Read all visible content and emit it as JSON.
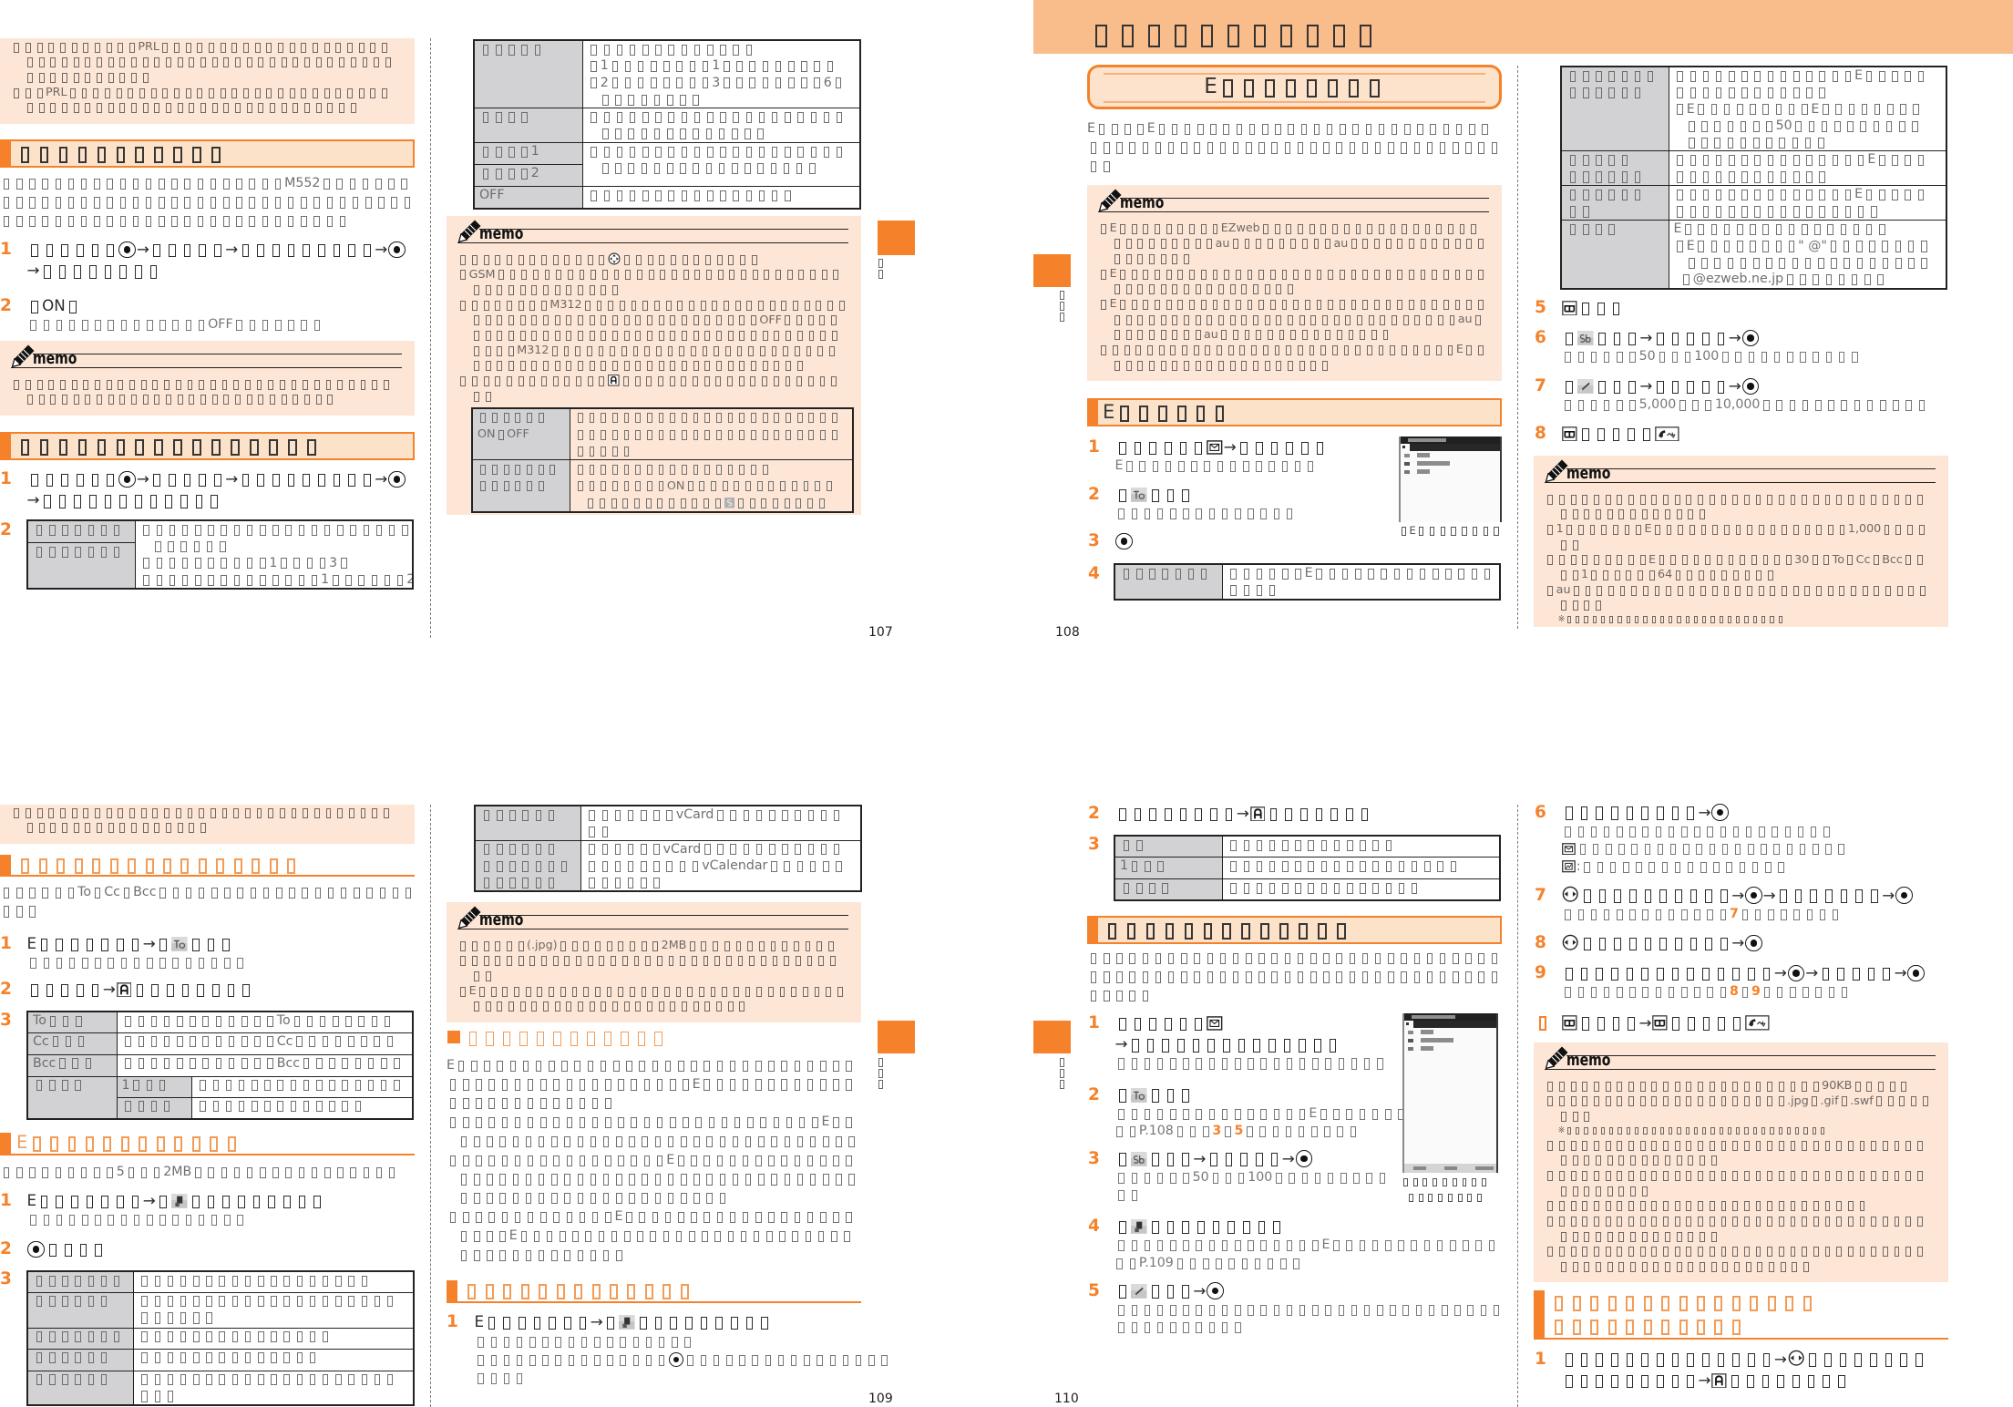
{
  "theme": {
    "accent": "#f5822a",
    "memo_bg": "#fde6d6",
    "heading_bg": "#fde2ca",
    "band_bg": "#f9bc8b",
    "table_label_bg": "#d2d2d4"
  },
  "p107": {
    "page_number": "107",
    "side_tab": "□□",
    "l": {
      "memo": {
        "items": [
          "□□□□□□□□□□□PRL□□□□□□□□□□□□□□□□□□□□□□□□□□□□□□□□□□□□□□□□□□□□□□□□□□□□□□□□□□□□□□□",
          "□□□PRL□□□□□□□□□□□□□□□□□□□□□□□□□□□□□□□□□□□□□□□□□□□□□□□□□□□□□□□□□"
        ]
      },
      "s1": {
        "title": "□□□□□□□□□□□",
        "body": "□□□□□□□□□□□□□□□□□□□□□□M552□□□□□□□□□□□□□□□□□□□□□□□□□□□□□□□□□□□□□□□□□□□□□□□□□□□□□□□□□□□□□□□□□□",
        "steps": [
          {
            "num": "1",
            "title": [
              "□□□□□□◉→□□□□□→□□□□□□□□□→◉",
              "→□□□□□□□□"
            ]
          },
          {
            "num": "2",
            "title": [
              "□ON□"
            ],
            "sub": [
              "□□□□□□□□□□□□□□OFF□□□□□□□"
            ]
          }
        ],
        "memo": {
          "title": "memo",
          "items": [
            "□□□□□□□□□□□□□□□□□□□□□□□□□□□□□□□□□□□□□□□□□□□□□□□□□□□□□□□□□□□□"
          ]
        }
      },
      "s2": {
        "title": "□□□□□□□□□□□□□□□□",
        "steps": [
          {
            "num": "1",
            "title": [
              "□□□□□□◉→□□□□□→□□□□□□□□□→◉",
              "→□□□□□□□□□□□□"
            ]
          },
          {
            "num": "2",
            "table": {
              "labels": [
                "□□□□□□□",
                "□□□□□□□"
              ],
              "desc": [
                "□□□□□□□□□□□□□□□□□□□□□",
                "□□□□□□",
                "□□□□□□□□□□1□□□□3□",
                "□□□□□□□□□□□□□□1□□□□□□2□"
              ]
            }
          }
        ]
      }
    },
    "r": {
      "table": {
        "rows": [
          {
            "label": "□□□□□",
            "desc": [
              "□□□□□□□□□□□□□",
              "□1□□□□□□□□1□□□□□□□□□",
              "□2□□□□□□□□3□□□□□□□□6□",
              "□□□□□□□□"
            ]
          },
          {
            "label": "□□□□",
            "desc": [
              "□□□□□□□□□□□□□□□□□□□□",
              "□□□□□□□□□□□□□"
            ]
          },
          {
            "label": "□□□□1",
            "desc": [
              "□□□□□□□□□□□□□□□□□□□□",
              "□□□□□□□□□□□□□□□□□"
            ]
          },
          {
            "label": "□□□□2"
          },
          {
            "label": "OFF",
            "desc": [
              "□□□□□□□□□□□□□□□□"
            ]
          }
        ]
      },
      "memo": {
        "title": "memo",
        "items": [
          "□□□□□□□□□□□□□⊕□□□□□□□□□□□□",
          "□GSM□□□□□□□□□□□□□□□□□□□□□□□□□□□□□□□□□□□□□□□□□□□",
          "□□□□□□□□M312□□□□□□□□□□□□□□□□□□□□□□□□□□□□□□□□□□□□□□□□□□□□□□□□OFF□□□□□□□□□□□□□□□□□□□□□□□□□□□□□□□□□□□□□□□□□M312□□□□□□□□□□□□□□□□□□□□□□□□□□□□□□□□□□□□□□□□□□□□□□□□□□□□□□",
          "□□□□□□□□□□□□□Ⓐ□□□□□□□□□□□□□□□□□□□□□"
        ],
        "table": {
          "rows": [
            {
              "label": [
                "□□□□□□",
                "ON□OFF"
              ],
              "desc": [
                "□□□□□□□□□□□□□□□□□□□□□□□",
                "□□□□□□□□□□□□□□□□□□□□□□□",
                "□□□□□"
              ]
            },
            {
              "label": [
                "□□□□□□□",
                "□□□□□□"
              ],
              "desc": [
                "□□□□□□□□□□□□□□□□□",
                "□□□□□□□□ON□□□□□□□□□□□□□",
                "□□□□□□□□□□□□ⓢ□□□□□□□□"
              ]
            }
          ]
        }
      }
    }
  },
  "p108": {
    "page_number": "108",
    "side_tab": "□□□",
    "chapter_title": "□□□□□□□□□□□",
    "topic_title": "E□□□□□□□□",
    "l": {
      "body": "E□□□□E□□□□□□□□□□□□□□□□□□□□□□□□□□□□□□□□□□□□□□□□□□□□□□□□□□□□□□□□□□□□",
      "memo": {
        "title": "memo",
        "items": [
          "□E□□□□□□□□□EZweb□□□□□□□□□□□□□□□□□□□□□□□□□□□□au□□□□□□□□□au□□□□□□□□□□□□□□□□□□□",
          "□E□□□□□□□□□□□□□□□□□□□□□□□□□□□□□□□□□□□□□□□□□□□□□□□□",
          "□E□□□□□□□□□□□□□□□□□□□□□□□□□□□□□□□□□□□□□□□□□□□□□□□□□□□□□□□□□□□□□□au□□□□□□□□□au□□□□□□□□□□□□□□□",
          "□□□□□□□□□□□□□□□□□□□□□□□□□□□□□□□E□□□□□□□□□□□□□□□□□□□□□"
        ]
      },
      "s1": {
        "title": "E□□□□□□",
        "steps": [
          {
            "num": "1",
            "title": [
              "□□□□□□✉→□□□□□□"
            ],
            "sub": [
              "E□□□□□□□□□□□□□□□"
            ]
          },
          {
            "num": "2",
            "title": [
              "□Ⓣ□□□"
            ],
            "sub": [
              "□□□□□□□□□□□□□□"
            ]
          },
          {
            "num": "3",
            "title": [
              "◉"
            ]
          },
          {
            "num": "4",
            "table": {
              "label": "□□□□□□□",
              "desc": [
                "□□□□□□E□□□□□□□□□□□□□□",
                "□□□□"
              ]
            }
          }
        ],
        "screen_caption": "□E□□□□□□□□"
      }
    },
    "r": {
      "table": {
        "rows": [
          {
            "label": [
              "□□□□□□□",
              "□□□□□□"
            ],
            "desc": [
              "□□□□□□□□□□□□□□E□□□□□",
              "□□□□□□□□□□□□",
              "□E□□□□□□□□□E□□□□□□□□",
              "□□□□□□□50□□□□□□□□□□",
              "□□□□□□□□□□□"
            ]
          },
          {
            "label": [
              "□□□□□",
              "□□□□□□"
            ],
            "desc": [
              "□□□□□□□□□□□□□□□E□□□□",
              "□□□□□□□□□□□□"
            ]
          },
          {
            "label": [
              "□□□□□□",
              "□□"
            ],
            "desc": [
              "□□□□□□□□□□□□□□E□□□□□",
              "□□□□□□□□□□□□□□□□"
            ]
          },
          {
            "label": [
              "□□□□"
            ],
            "desc": [
              "E□□□□□□□□□□□□□□□□",
              "□E□□□□□□□□\" @\"□□□□□□□□",
              "□□□□□□□□□□□□□□□□□□□",
              "□@ezweb.ne.jp□□□□□□□□"
            ]
          }
        ]
      },
      "steps": [
        {
          "num": "5",
          "title": [
            "▦□□□"
          ]
        },
        {
          "num": "6",
          "title": [
            "□Ⓢ□□□→□□□□□→◉"
          ],
          "sub": [
            "□□□□□□50□□□100□□□□□□□□□□□"
          ]
        },
        {
          "num": "7",
          "title": [
            "□✎□□□→□□□□□→◉"
          ],
          "sub": [
            "□□□□□□5,000□□□10,000□□□□□□□□□□□□□"
          ]
        },
        {
          "num": "8",
          "title": [
            "▦□□□□□☎"
          ]
        }
      ],
      "memo": {
        "title": "memo",
        "items": [
          "□□□□□□□□□□□□□□□□□□□□□□□□□□□□□□□□□□□□□□□□□□□□□□",
          "□1□□□□□□□E□□□□□□□□□□□□□□□□□1,000□□□□□□",
          "□□□□□□□□□E□□□□□□□□□□□□30□□To□Cc□Bcc□□□□1□□□□□□64□□□□□□□□□",
          "□au□□□□□□□□□□□□□□□□□□□□□□□□□□□□□□□□□□□"
        ],
        "note": "※□□□□□□□□□□□□□□□□□□□□□□□□□□"
      }
    }
  },
  "p109": {
    "page_number": "109",
    "side_tab": "□□□",
    "l": {
      "memo": {
        "items": [
          "□□□□□□□□□□□□□□□□□□□□□□□□□□□□□□□□□□□□□□□□□□□□□□□□□"
        ]
      },
      "s1": {
        "title": "□□□□□□□□□□□□□□□□",
        "body": "□□□□□□To□Cc□Bcc□□□□□□□□□□□□□□□□□□□□□□□",
        "steps": [
          {
            "num": "1",
            "title": [
              "E□□□□□□□→□Ⓣ□□□"
            ],
            "sub": [
              "□□□□□□□□□□□□□□□□□"
            ]
          },
          {
            "num": "2",
            "title": [
              "□□□□□→Ⓐ□□□□□□□□"
            ]
          },
          {
            "num": "3",
            "table": {
              "rows": [
                {
                  "label": "To□□□",
                  "desc": [
                    "□□□□□□□□□□□□To□□□□□□□□"
                  ]
                },
                {
                  "label": "Cc□□□",
                  "desc": [
                    "□□□□□□□□□□□□Cc□□□□□□□□"
                  ]
                },
                {
                  "label": "Bcc□□□",
                  "desc": [
                    "□□□□□□□□□□□□Bcc□□□□□□□□"
                  ]
                },
                {
                  "label": "□□□□",
                  "sub_rows": [
                    {
                      "label": "1□□□",
                      "desc": [
                        "□□□□□□□□□□□□□□□□"
                      ]
                    },
                    {
                      "label": "□□□□",
                      "desc": [
                        "□□□□□□□□□□□□□"
                      ]
                    }
                  ]
                }
              ]
            }
          }
        ]
      },
      "s2": {
        "title": "E□□□□□□□□□□□□",
        "body": "□□□□□□□□□5□□□2MB□□□□□□□□□□□□□□□□",
        "steps": [
          {
            "num": "1",
            "title": [
              "E□□□□□□□→□⎘□□□□□□□□□"
            ],
            "sub": [
              "□□□□□□□□□□□□□□□□□"
            ]
          },
          {
            "num": "2",
            "title": [
              "◉□□□□"
            ]
          },
          {
            "num": "3",
            "table": {
              "rows": [
                {
                  "label": "□□□□□□□",
                  "desc": [
                    "□□□□□□□□□□□□□□□□□□"
                  ]
                },
                {
                  "label": "□□□□□□",
                  "desc": [
                    "□□□□□□□□□□□□□□□□□□□□",
                    "□□□□□□"
                  ]
                },
                {
                  "label": "□□□□□□□",
                  "desc": [
                    "□□□□□□□□□□□□□□□"
                  ]
                },
                {
                  "label": "□□□□□□",
                  "desc": [
                    "□□□□□□□□□□□□□□"
                  ]
                },
                {
                  "label": "□□□□□□",
                  "desc": [
                    "□□□□□□□□□□□□□□□□□□□□",
                    "□□□"
                  ]
                }
              ]
            }
          }
        ]
      }
    },
    "r": {
      "table": {
        "rows": [
          {
            "label": [
              "□□□□□□"
            ],
            "desc": [
              "□□□□□□□vCard□□□□□□□□□□",
              "□□"
            ]
          },
          {
            "label": [
              "□□□□□□",
              "□□□□□□□",
              "□□□□□□"
            ],
            "desc": [
              "□□□□□□vCard□□□□□□□□□□□",
              "□□□□□□□□□vCalendar□□□□□□",
              "□□□□□□"
            ]
          }
        ]
      },
      "memo": {
        "title": "memo",
        "items": [
          "□□□□□□(.jpg)□□□□□□□□□2MB□□□□□□□□□□□□□",
          "□□□□□□□□□□□□□□□□□□□□□□□□□□□□□□□□□□□",
          "□E□□□□□□□□□□□□□□□□□□□□□□□□□□□□□□□□□□□□□□□□□□□□□□□□□□□□□□□□"
        ]
      },
      "s1": {
        "title": "□□□□□□□□□□□□",
        "paras": [
          "E□□□□□□□□□□□□□□□□□□□□□□□□□□□□□□□□□□□□□□□□□□□□□□□□□□E□□□□□□□□□□□□□□□□□□□□□□□□□",
          "□□□□□□□□□□□□□□□□□□□□□□□□□□□□□E□□□□□□□□□□□□□□□□□□□□□□□□□□□□□□□□□",
          "□□□□□□□□□□□□□□□□□E□□□□□□□□□□□□□□□□□□□□□□□□□□□□□□□□□□□□□□□□□□□□□□□□□□□□□□□□□□□□□□□□□□",
          "□□□□□□□□□□□□□E□□□□□□□□□□□□□□□□□□□□□□E□□□□□□□□□□□□□□□□□□□□□□□□□□□□□□□□□□□□□□□"
        ]
      },
      "s2": {
        "title": "□□□□□□□□□□□□□",
        "steps": [
          {
            "num": "1",
            "title": [
              "E□□□□□□□→□⎘□□□□□□□□□"
            ],
            "sub": [
              "□□□□□□□□□□□□□□□□□",
              "□□□□□□□□□□□□□□□◉□□□□□□□□□□□□□□□□",
              "□□□□"
            ]
          }
        ]
      }
    }
  },
  "p110": {
    "page_number": "110",
    "side_tab": "□□□",
    "l": {
      "steps_top": [
        {
          "num": "2",
          "title": [
            "□□□□□□□□→Ⓐ□□□□□□□"
          ]
        },
        {
          "num": "3",
          "table": {
            "rows": [
              {
                "label": "□□",
                "desc": [
                  "□□□□□□□□□□□□□"
                ]
              },
              {
                "label": "1□□□",
                "desc": [
                  "□□□□□□□□□□□□□□□□□□"
                ]
              },
              {
                "label": "□□□□",
                "desc": [
                  "□□□□□□□□□□□□□□□"
                ]
              }
            ]
          }
        }
      ],
      "s1": {
        "title": "□□□□□□□□□□□□□",
        "body": "□□□□□□□□□□□□□□□□□□□□□□□□□□□□□□□□□□□□□□□□□□□□□□□□□□□□□□□□□□□□□□□□□□□□□",
        "steps": [
          {
            "num": "1",
            "title": [
              "□□□□□□✉",
              "→□□□□□□□□□□□□□□"
            ],
            "sub": [
              "□□□□□□□□□□□□□□□□□□□□□"
            ]
          },
          {
            "num": "2",
            "title": [
              "□Ⓣ□□□"
            ],
            "sub": [
              "□□□□□□□□□□□□□□□E□□□□□□□",
              "□□P.108□□□３□５□□□□□□□□□"
            ]
          },
          {
            "num": "3",
            "title": [
              "□Ⓢ□□□→□□□□□→◉"
            ],
            "sub": [
              "□□□□□□50□□□100□□□□□□□□□",
              "□□"
            ]
          },
          {
            "num": "4",
            "title": [
              "□⎘□□□□□□□□□"
            ],
            "sub": [
              "□□□□□□□□□□□□□□□□E□□□□□□□□□□□□□",
              "□□P.109□□□□□□□□□□"
            ]
          },
          {
            "num": "5",
            "title": [
              "□✎□□□→◉"
            ],
            "sub": [
              "□□□□□□□□□□□□□□□□□□□□□□□□□□□□□□",
              "□□□□□□□□□□"
            ]
          }
        ],
        "screen_caption": [
          "□□□□□□□□□",
          "□□□□□□□□"
        ]
      }
    },
    "r": {
      "steps": [
        {
          "num": "6",
          "title": [
            "□□□□□□□□□→◉"
          ],
          "sub": [
            "□□□□□□□□□□□□□□□□□□□□□",
            "✉□□□□□□□□□□□□□□□□□□□□□",
            "▣:□□□□□□□□□□□□□□□□"
          ]
        },
        {
          "num": "7",
          "title": [
            "⇆□□□□□□□□□□→◉→□□□□□□□→◉"
          ],
          "sub": [
            "□□□□□□□□□□□□□７□□□□□□□□"
          ]
        },
        {
          "num": "8",
          "title": [
            "⇆□□□□□□□□□□→◉"
          ]
        },
        {
          "num": "9",
          "title": [
            "□□□□□□□□□□□□□□→◉→□□□□□→◉"
          ],
          "sub": [
            "□□□□□□□□□□□□□８□９□□□□□□□"
          ]
        },
        {
          "num": "□",
          "title": [
            "▦□□□□→▦□□□□□☎"
          ]
        }
      ],
      "memo": {
        "title": "memo",
        "items": [
          "□□□□□□□□□□□□□□□□□□□□□□□□90KB□□□□□",
          "□□□□□□□□□□□□□□□□□□□□□.jpg□.gif□.swf□□□□□□□□",
          "□□□□□□□□□□□□□□□□□□□□□□□□□□□□□□□□□□□□□□□□□□□□□□□",
          "□□□□□□□□□□□□□□□□□□□□□□□□□□□□□□□□□□□□□□□□□",
          "□□□□□□□□□□□□□□□□□□□□□□□□□□□□",
          "□□□□□□□□□□□□□□□□□□□□□□□□□□□□□□□□□□□□□□□□□□□□□□□",
          "□□□□□□□□□□□□□□□□□□□□□□□□□□□□□□□□□□□□□□□□□□□□□□□□□□□□□□□"
        ],
        "note": "※□□□□□□□□□□□□□□□□□□□□□□□□□□□□□□□"
      },
      "s1": {
        "title": [
          "□□□□□□□□□□□□□□□",
          "□□□□□□□□□□□"
        ],
        "steps": [
          {
            "num": "1",
            "title": [
              "□□□□□□□□□□□□□□→⇆□□□□□□□□",
              "□□□□□□□□□→Ⓐ□□□□□□□□"
            ]
          }
        ]
      }
    }
  }
}
